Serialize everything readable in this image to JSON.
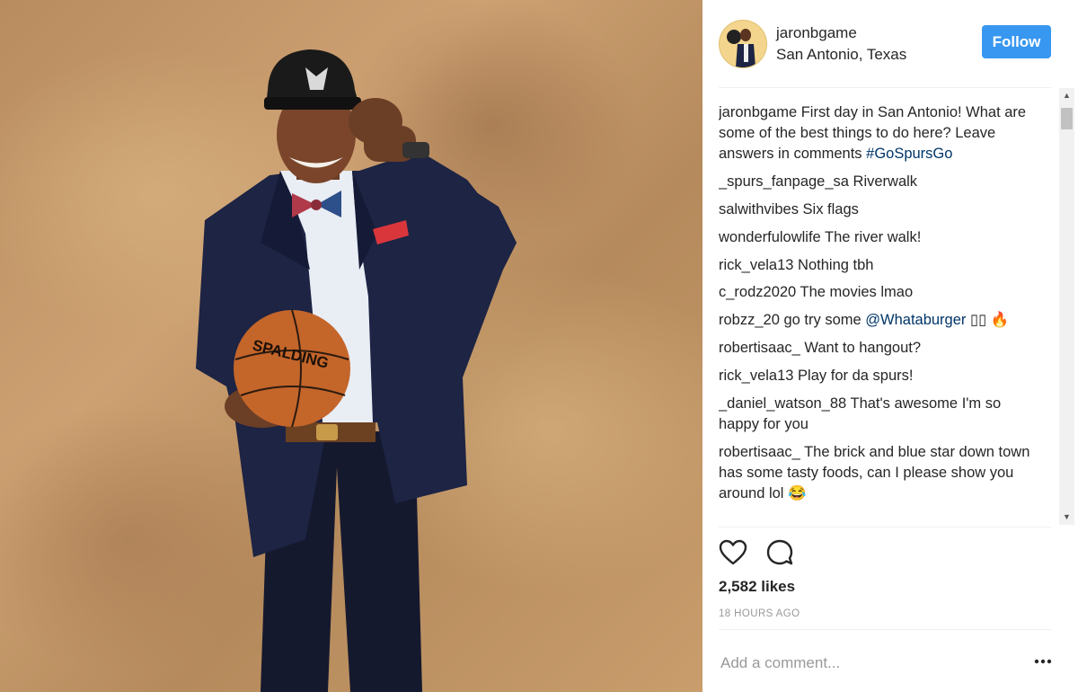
{
  "post": {
    "photo_alt": "",
    "ball_brand": "SPALDING"
  },
  "header": {
    "username": "jaronbgame",
    "location": "San Antonio, Texas",
    "follow_label": "Follow"
  },
  "caption": {
    "user": "jaronbgame",
    "text": " First day in San Antonio! What are some of the best things to do here? Leave answers in comments ",
    "hashtag": "#GoSpursGo"
  },
  "comments": [
    {
      "user": "_spurs_fanpage_sa",
      "text": " Riverwalk"
    },
    {
      "user": "salwithvibes",
      "text": " Six flags"
    },
    {
      "user": "wonderfulowlife",
      "text": " The river walk!"
    },
    {
      "user": "rick_vela13",
      "text": " Nothing tbh"
    },
    {
      "user": "c_rodz2020",
      "text": " The movies lmao"
    },
    {
      "user": "robzz_20",
      "text": " go try some ",
      "mention": "@Whataburger",
      "tail": " ▯▯ 🔥"
    },
    {
      "user": "robertisaac_",
      "text": " Want to hangout?"
    },
    {
      "user": "rick_vela13",
      "text": " Play for da spurs!"
    },
    {
      "user": "_daniel_watson_88",
      "text": " That's awesome I'm so happy for you"
    },
    {
      "user": "robertisaac_",
      "text": " The brick and blue star down town has some tasty foods, can I please show you around lol 😂"
    }
  ],
  "stats": {
    "likes": "2,582 likes",
    "time": "18 HOURS AGO"
  },
  "add_comment": {
    "placeholder": "Add a comment..."
  },
  "icons": {
    "like": "heart-icon",
    "comment": "comment-bubble-icon",
    "more": "more-dots-icon"
  },
  "colors": {
    "follow": "#3897f0",
    "hashtag": "#003569",
    "muted": "#999999"
  }
}
